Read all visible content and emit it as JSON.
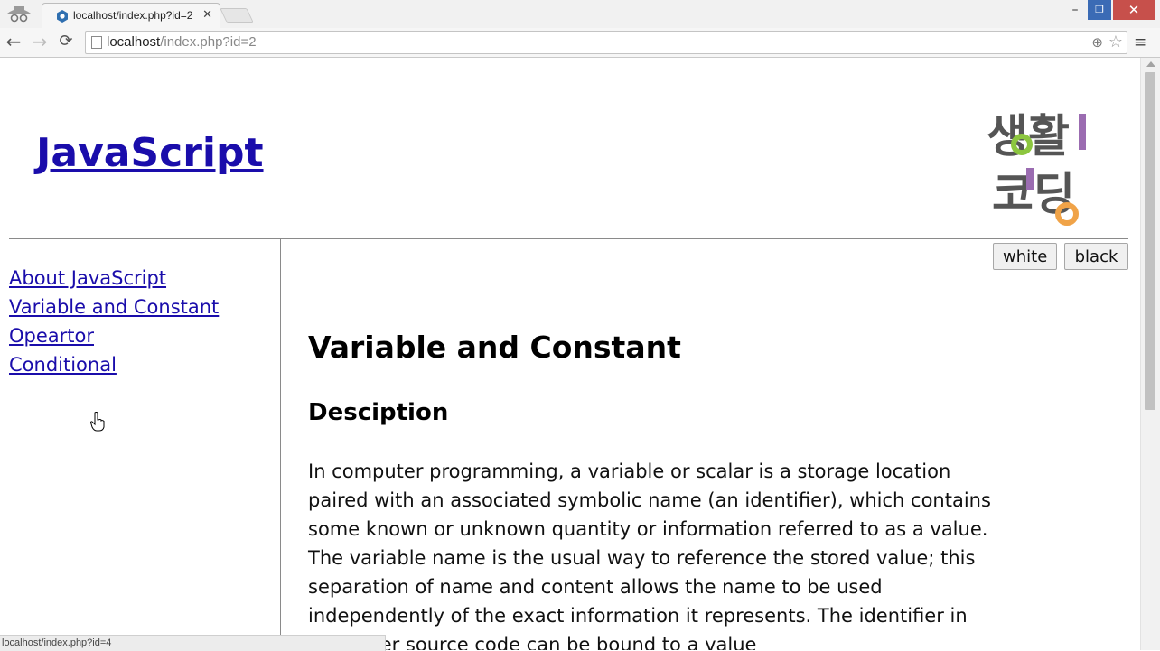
{
  "browser": {
    "tab": {
      "title": "localhost/index.php?id=2",
      "close_label": "✕"
    },
    "window_buttons": {
      "minimize": "–",
      "maximize": "❐",
      "close": "✕"
    },
    "toolbar": {
      "back": "←",
      "forward": "→",
      "reload": "⟳",
      "menu": "≡",
      "zoom": "⊕",
      "star": "☆"
    },
    "address": {
      "host": "localhost",
      "path": "/index.php?id=2"
    },
    "status": "localhost/index.php?id=4",
    "icons": {
      "incognito": "incognito-icon",
      "favicon": "favicon-icon",
      "page": "page-icon"
    }
  },
  "page": {
    "site_title": "JavaScript",
    "logo": {
      "line1": "생활",
      "line2": "코딩",
      "colors": {
        "text": "#555555",
        "green": "#8cc63f",
        "purple": "#9b6cb1",
        "orange": "#f0a348"
      }
    },
    "nav": [
      {
        "label": "About JavaScript"
      },
      {
        "label": "Variable and Constant"
      },
      {
        "label": "Opeartor"
      },
      {
        "label": "Conditional"
      }
    ],
    "buttons": {
      "white": "white",
      "black": "black"
    },
    "article": {
      "title": "Variable and Constant",
      "section": "Desciption",
      "body": "In computer programming, a variable or scalar is a storage location paired with an associated symbolic name (an identifier), which contains some known or unknown quantity or information referred to as a value. The variable name is the usual way to reference the stored value; this separation of name and content allows the name to be used independently of the exact information it represents. The identifier in computer source code can be bound to a value"
    }
  },
  "colors": {
    "link": "#1a0dab",
    "chrome": "#f1f1f1",
    "close_button": "#c7504b",
    "max_button": "#3b6bb5"
  }
}
